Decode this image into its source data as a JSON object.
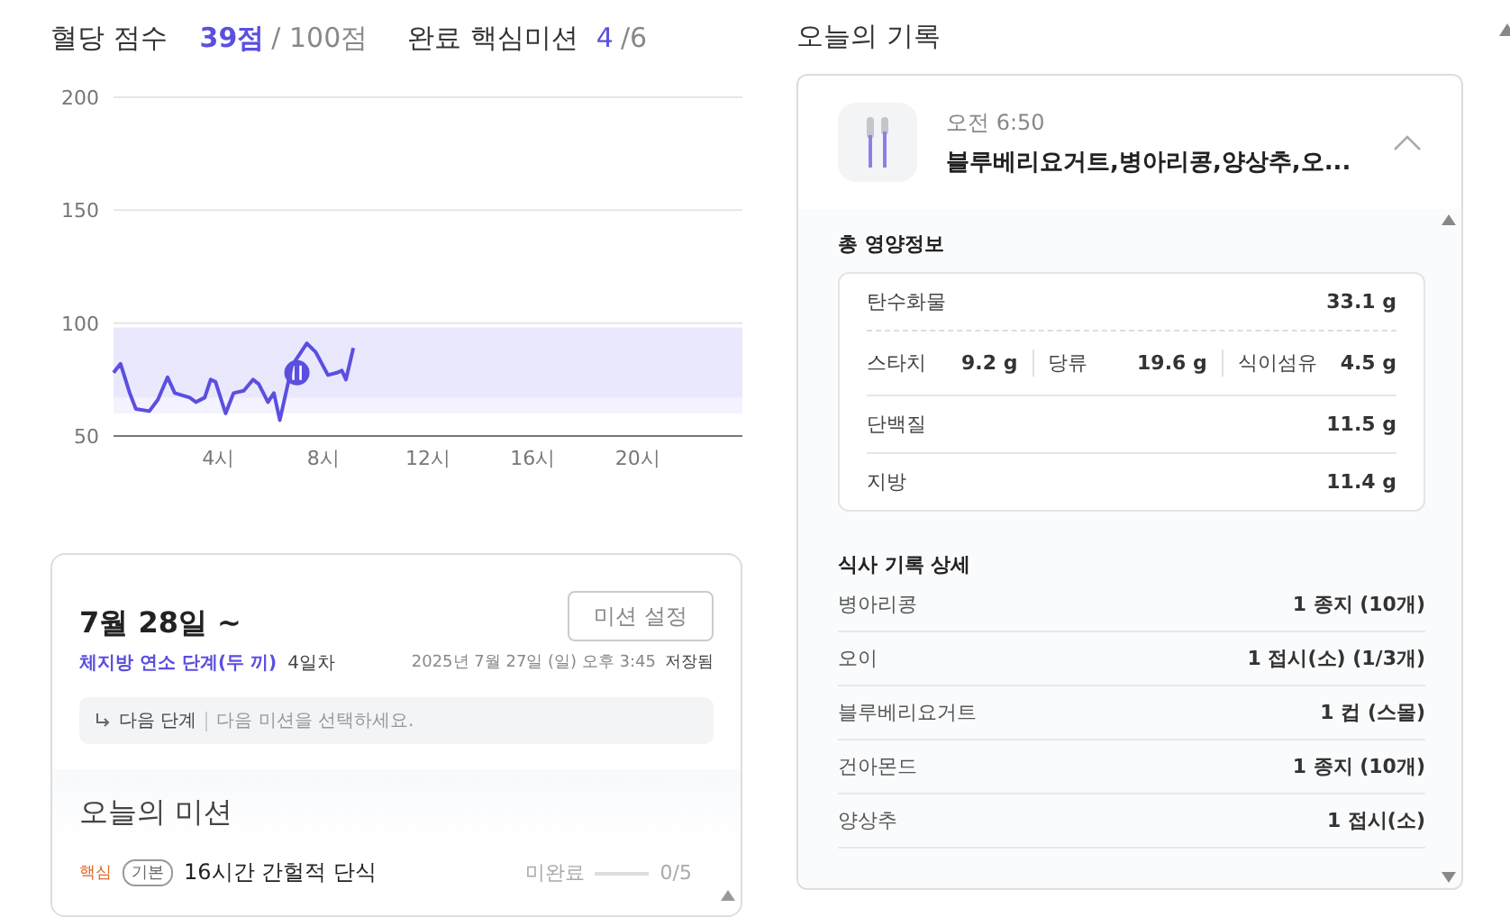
{
  "score": {
    "label": "혈당 점수",
    "value": "39점",
    "total": "/ 100점"
  },
  "missions_done": {
    "label": "완료 핵심미션",
    "done": "4",
    "total": "/6"
  },
  "glucose_chart": {
    "chart_data": {
      "type": "line",
      "x": [
        0,
        0.27,
        0.62,
        0.85,
        1.37,
        1.69,
        2.06,
        2.34,
        2.91,
        3.14,
        3.48,
        3.71,
        3.89,
        4.28,
        4.58,
        4.97,
        5.32,
        5.54,
        5.89,
        6.12,
        6.35,
        6.81,
        7.38,
        7.72,
        8.18,
        8.53,
        8.71,
        8.87,
        9.15
      ],
      "series": [
        {
          "color": "#5b4fe0",
          "values": [
            78,
            82,
            69,
            62,
            61,
            66,
            76,
            69,
            67,
            65,
            67,
            75,
            74,
            60,
            69,
            70,
            75,
            73,
            65,
            69,
            57,
            81,
            91,
            87,
            77,
            78,
            79,
            75,
            89
          ]
        }
      ],
      "xlim": [
        0,
        24
      ],
      "ylim": [
        50,
        200
      ],
      "bands": [
        {
          "axis": "y",
          "from": 60,
          "to": 98,
          "color": "#f3f2fe"
        },
        {
          "axis": "y",
          "from": 67,
          "to": 98,
          "color": "#e9e8fd"
        }
      ],
      "xticks": [
        {
          "value": 4,
          "label": "4시"
        },
        {
          "value": 8,
          "label": "8시"
        },
        {
          "value": 12,
          "label": "12시"
        },
        {
          "value": 16,
          "label": "16시"
        },
        {
          "value": 20,
          "label": "20시"
        }
      ],
      "yticks": [
        50,
        100,
        150,
        200
      ]
    }
  },
  "mission_card": {
    "date": "7월 28일 ~",
    "stage": "체지방 연소 단계(두 끼)",
    "day": "4일차",
    "button": "미션 설정",
    "saved_time": "2025년 7월 27일 (일) 오후 3:45",
    "saved_label": "저장됨",
    "next_step": {
      "label": "다음 단계",
      "hint": "다음 미션을 선택하세요."
    }
  },
  "todays_missions": {
    "title": "오늘의 미션",
    "items": [
      {
        "core_tag": "핵심",
        "level_tag": "기본",
        "name": "16시간 간헐적 단식",
        "status": "미완료",
        "level": 0,
        "progress": "0/5"
      }
    ]
  },
  "today_log": {
    "title": "오늘의 기록",
    "meal": {
      "time": "오전 6:50",
      "title": "블루베리요거트,병아리콩,양상추,오...",
      "expanded": true,
      "nutrition_title": "총 영양정보",
      "nutrients": [
        {
          "kind": "main",
          "name": "탄수화물",
          "amount": "33.1 g"
        },
        {
          "kind": "split",
          "parts": [
            {
              "name": "스타치",
              "amount": "9.2 g"
            },
            {
              "name": "당류",
              "amount": "19.6 g"
            },
            {
              "name": "식이섬유",
              "amount": "4.5 g"
            }
          ]
        },
        {
          "kind": "main",
          "name": "단백질",
          "amount": "11.5 g"
        },
        {
          "kind": "main",
          "name": "지방",
          "amount": "11.4 g"
        }
      ],
      "detail_title": "식사 기록 상세",
      "items": [
        {
          "name": "병아리콩",
          "amount": "1 종지 (10개)"
        },
        {
          "name": "오이",
          "amount": "1 접시(소) (1/3개)"
        },
        {
          "name": "블루베리요거트",
          "amount": "1 컵 (스몰)"
        },
        {
          "name": "건아몬드",
          "amount": "1 종지 (10개)"
        },
        {
          "name": "양상추",
          "amount": "1 접시(소)"
        }
      ]
    }
  }
}
